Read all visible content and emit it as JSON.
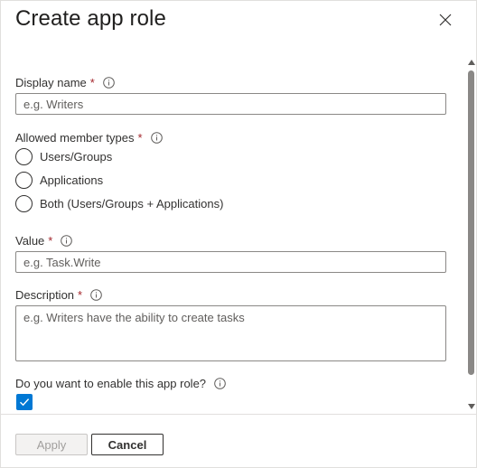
{
  "dialog": {
    "title": "Create app role"
  },
  "form": {
    "display_name": {
      "label": "Display name",
      "required": "*",
      "placeholder": "e.g. Writers",
      "value": ""
    },
    "member_types": {
      "label": "Allowed member types",
      "required": "*",
      "options": [
        {
          "label": "Users/Groups",
          "selected": false
        },
        {
          "label": "Applications",
          "selected": false
        },
        {
          "label": "Both (Users/Groups + Applications)",
          "selected": false
        }
      ]
    },
    "value": {
      "label": "Value",
      "required": "*",
      "placeholder": "e.g. Task.Write",
      "value": ""
    },
    "description": {
      "label": "Description",
      "required": "*",
      "placeholder": "e.g. Writers have the ability to create tasks",
      "value": ""
    },
    "enable": {
      "label": "Do you want to enable this app role?",
      "checked": true
    }
  },
  "footer": {
    "apply_label": "Apply",
    "cancel_label": "Cancel"
  },
  "colors": {
    "accent": "#0078d4",
    "required": "#a4262c",
    "border": "#8a8886"
  },
  "icons": {
    "close": "close-icon",
    "info": "info-icon",
    "check": "checkmark-icon"
  }
}
